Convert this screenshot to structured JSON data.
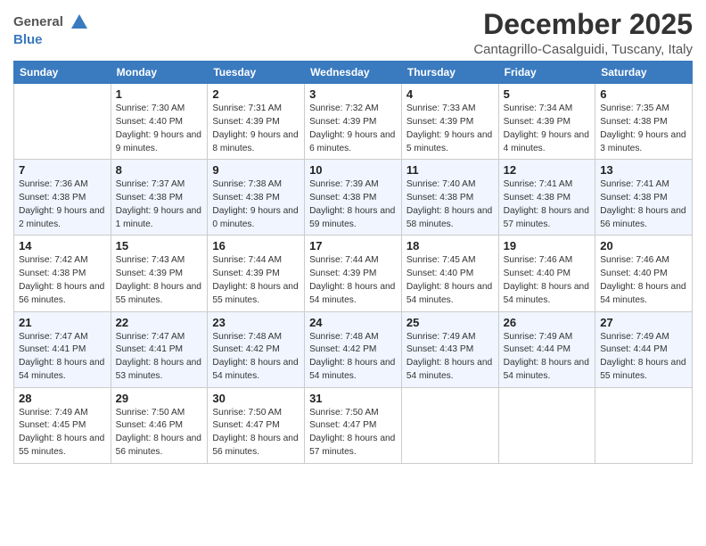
{
  "logo": {
    "general": "General",
    "blue": "Blue"
  },
  "title": "December 2025",
  "location": "Cantagrillo-Casalguidi, Tuscany, Italy",
  "weekdays": [
    "Sunday",
    "Monday",
    "Tuesday",
    "Wednesday",
    "Thursday",
    "Friday",
    "Saturday"
  ],
  "weeks": [
    [
      {
        "day": "",
        "sunrise": "",
        "sunset": "",
        "daylight": ""
      },
      {
        "day": "1",
        "sunrise": "Sunrise: 7:30 AM",
        "sunset": "Sunset: 4:40 PM",
        "daylight": "Daylight: 9 hours and 9 minutes."
      },
      {
        "day": "2",
        "sunrise": "Sunrise: 7:31 AM",
        "sunset": "Sunset: 4:39 PM",
        "daylight": "Daylight: 9 hours and 8 minutes."
      },
      {
        "day": "3",
        "sunrise": "Sunrise: 7:32 AM",
        "sunset": "Sunset: 4:39 PM",
        "daylight": "Daylight: 9 hours and 6 minutes."
      },
      {
        "day": "4",
        "sunrise": "Sunrise: 7:33 AM",
        "sunset": "Sunset: 4:39 PM",
        "daylight": "Daylight: 9 hours and 5 minutes."
      },
      {
        "day": "5",
        "sunrise": "Sunrise: 7:34 AM",
        "sunset": "Sunset: 4:39 PM",
        "daylight": "Daylight: 9 hours and 4 minutes."
      },
      {
        "day": "6",
        "sunrise": "Sunrise: 7:35 AM",
        "sunset": "Sunset: 4:38 PM",
        "daylight": "Daylight: 9 hours and 3 minutes."
      }
    ],
    [
      {
        "day": "7",
        "sunrise": "Sunrise: 7:36 AM",
        "sunset": "Sunset: 4:38 PM",
        "daylight": "Daylight: 9 hours and 2 minutes."
      },
      {
        "day": "8",
        "sunrise": "Sunrise: 7:37 AM",
        "sunset": "Sunset: 4:38 PM",
        "daylight": "Daylight: 9 hours and 1 minute."
      },
      {
        "day": "9",
        "sunrise": "Sunrise: 7:38 AM",
        "sunset": "Sunset: 4:38 PM",
        "daylight": "Daylight: 9 hours and 0 minutes."
      },
      {
        "day": "10",
        "sunrise": "Sunrise: 7:39 AM",
        "sunset": "Sunset: 4:38 PM",
        "daylight": "Daylight: 8 hours and 59 minutes."
      },
      {
        "day": "11",
        "sunrise": "Sunrise: 7:40 AM",
        "sunset": "Sunset: 4:38 PM",
        "daylight": "Daylight: 8 hours and 58 minutes."
      },
      {
        "day": "12",
        "sunrise": "Sunrise: 7:41 AM",
        "sunset": "Sunset: 4:38 PM",
        "daylight": "Daylight: 8 hours and 57 minutes."
      },
      {
        "day": "13",
        "sunrise": "Sunrise: 7:41 AM",
        "sunset": "Sunset: 4:38 PM",
        "daylight": "Daylight: 8 hours and 56 minutes."
      }
    ],
    [
      {
        "day": "14",
        "sunrise": "Sunrise: 7:42 AM",
        "sunset": "Sunset: 4:38 PM",
        "daylight": "Daylight: 8 hours and 56 minutes."
      },
      {
        "day": "15",
        "sunrise": "Sunrise: 7:43 AM",
        "sunset": "Sunset: 4:39 PM",
        "daylight": "Daylight: 8 hours and 55 minutes."
      },
      {
        "day": "16",
        "sunrise": "Sunrise: 7:44 AM",
        "sunset": "Sunset: 4:39 PM",
        "daylight": "Daylight: 8 hours and 55 minutes."
      },
      {
        "day": "17",
        "sunrise": "Sunrise: 7:44 AM",
        "sunset": "Sunset: 4:39 PM",
        "daylight": "Daylight: 8 hours and 54 minutes."
      },
      {
        "day": "18",
        "sunrise": "Sunrise: 7:45 AM",
        "sunset": "Sunset: 4:40 PM",
        "daylight": "Daylight: 8 hours and 54 minutes."
      },
      {
        "day": "19",
        "sunrise": "Sunrise: 7:46 AM",
        "sunset": "Sunset: 4:40 PM",
        "daylight": "Daylight: 8 hours and 54 minutes."
      },
      {
        "day": "20",
        "sunrise": "Sunrise: 7:46 AM",
        "sunset": "Sunset: 4:40 PM",
        "daylight": "Daylight: 8 hours and 54 minutes."
      }
    ],
    [
      {
        "day": "21",
        "sunrise": "Sunrise: 7:47 AM",
        "sunset": "Sunset: 4:41 PM",
        "daylight": "Daylight: 8 hours and 54 minutes."
      },
      {
        "day": "22",
        "sunrise": "Sunrise: 7:47 AM",
        "sunset": "Sunset: 4:41 PM",
        "daylight": "Daylight: 8 hours and 53 minutes."
      },
      {
        "day": "23",
        "sunrise": "Sunrise: 7:48 AM",
        "sunset": "Sunset: 4:42 PM",
        "daylight": "Daylight: 8 hours and 54 minutes."
      },
      {
        "day": "24",
        "sunrise": "Sunrise: 7:48 AM",
        "sunset": "Sunset: 4:42 PM",
        "daylight": "Daylight: 8 hours and 54 minutes."
      },
      {
        "day": "25",
        "sunrise": "Sunrise: 7:49 AM",
        "sunset": "Sunset: 4:43 PM",
        "daylight": "Daylight: 8 hours and 54 minutes."
      },
      {
        "day": "26",
        "sunrise": "Sunrise: 7:49 AM",
        "sunset": "Sunset: 4:44 PM",
        "daylight": "Daylight: 8 hours and 54 minutes."
      },
      {
        "day": "27",
        "sunrise": "Sunrise: 7:49 AM",
        "sunset": "Sunset: 4:44 PM",
        "daylight": "Daylight: 8 hours and 55 minutes."
      }
    ],
    [
      {
        "day": "28",
        "sunrise": "Sunrise: 7:49 AM",
        "sunset": "Sunset: 4:45 PM",
        "daylight": "Daylight: 8 hours and 55 minutes."
      },
      {
        "day": "29",
        "sunrise": "Sunrise: 7:50 AM",
        "sunset": "Sunset: 4:46 PM",
        "daylight": "Daylight: 8 hours and 56 minutes."
      },
      {
        "day": "30",
        "sunrise": "Sunrise: 7:50 AM",
        "sunset": "Sunset: 4:47 PM",
        "daylight": "Daylight: 8 hours and 56 minutes."
      },
      {
        "day": "31",
        "sunrise": "Sunrise: 7:50 AM",
        "sunset": "Sunset: 4:47 PM",
        "daylight": "Daylight: 8 hours and 57 minutes."
      },
      {
        "day": "",
        "sunrise": "",
        "sunset": "",
        "daylight": ""
      },
      {
        "day": "",
        "sunrise": "",
        "sunset": "",
        "daylight": ""
      },
      {
        "day": "",
        "sunrise": "",
        "sunset": "",
        "daylight": ""
      }
    ]
  ]
}
